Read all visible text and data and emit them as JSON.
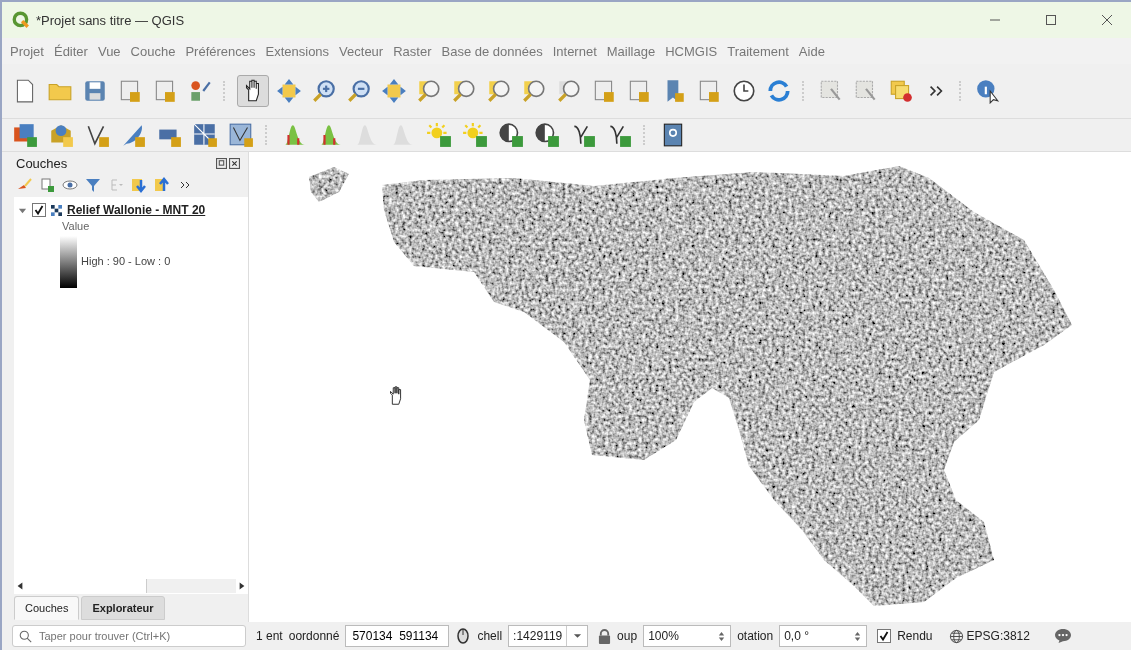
{
  "window": {
    "title": "*Projet sans titre — QGIS"
  },
  "menu": [
    "Projet",
    "Éditer",
    "Vue",
    "Couche",
    "Préférences",
    "Extensions",
    "Vecteur",
    "Raster",
    "Base de données",
    "Internet",
    "Maillage",
    "HCMGIS",
    "Traitement",
    "Aide"
  ],
  "layers_panel": {
    "title": "Couches",
    "layers": [
      {
        "name": "Relief Wallonie - MNT 20",
        "checked": true,
        "expanded": true,
        "legend_title": "Value",
        "legend_label": "High : 90 - Low : 0"
      }
    ],
    "tabs": [
      {
        "label": "Couches",
        "selected": true
      },
      {
        "label": "Explorateur",
        "selected": false
      }
    ]
  },
  "status_bar": {
    "search_placeholder": "Taper pour trouver (Ctrl+K)",
    "entities": "1 ent",
    "coordinate_label": "oordonné",
    "coordinate": "570134  591134",
    "scale_label": "chell",
    "scale": ":1429119",
    "magnifier_label": "oup",
    "magnifier": "100%",
    "rotation_label": "otation",
    "rotation": "0,0 °",
    "render_label": "Rendu",
    "render": true,
    "crs": "EPSG:3812"
  }
}
